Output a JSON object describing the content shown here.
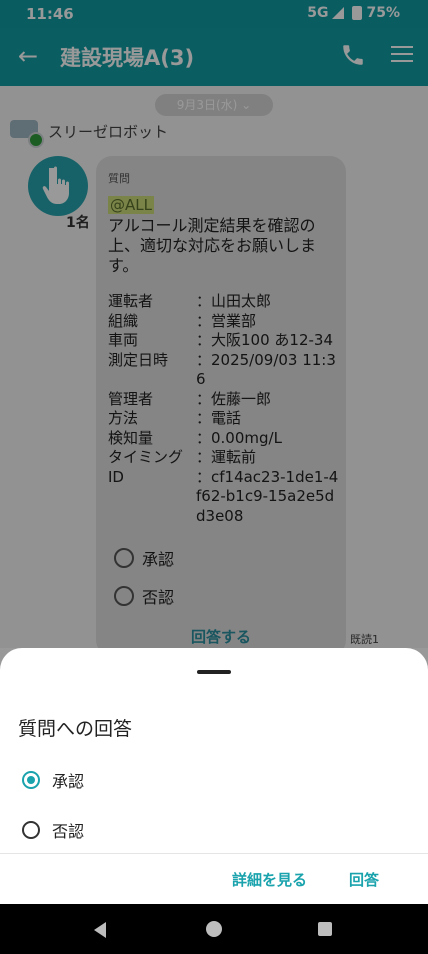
{
  "status_bar": {
    "time": "11:46",
    "network": "5G",
    "battery": "75%"
  },
  "app_bar": {
    "title": "建設現場A(3)",
    "icons": [
      "back-arrow-icon",
      "phone-icon",
      "hamburger-menu-icon"
    ]
  },
  "chat": {
    "date_chip": "9月3日(水) ⌄",
    "sender": "スリーゼロボット",
    "avatar_label": "1名",
    "message": {
      "label": "質問",
      "mention": "@ALL",
      "body": "アルコール測定結果を確認の上、適切な対応をお願いします。",
      "details": [
        {
          "key": "運転者",
          "value": "：山田太郎"
        },
        {
          "key": "組織",
          "value": "：営業部"
        },
        {
          "key": "車両",
          "value": "：大阪100 あ12-34"
        },
        {
          "key": "測定日時",
          "value": "：2025/09/03 11:36"
        },
        {
          "key": "管理者",
          "value": "：佐藤一郎"
        },
        {
          "key": "方法",
          "value": "：電話"
        },
        {
          "key": "検知量",
          "value": "：0.00mg/L"
        },
        {
          "key": "タイミング",
          "value": "：運転前"
        },
        {
          "key": "ID",
          "value": "：cf14ac23-1de1-4f62-b1c9-15a2e5dd3e08"
        }
      ],
      "options": [
        "承認",
        "否認"
      ],
      "answer_link": "回答する",
      "read_status": "既読1"
    }
  },
  "sheet": {
    "title": "質問への回答",
    "options": [
      {
        "label": "承認",
        "selected": true
      },
      {
        "label": "否認",
        "selected": false
      }
    ],
    "details_button": "詳細を見る",
    "answer_button": "回答"
  },
  "colors": {
    "accent": "#1aa3ad",
    "app_bar": "#119da3"
  }
}
